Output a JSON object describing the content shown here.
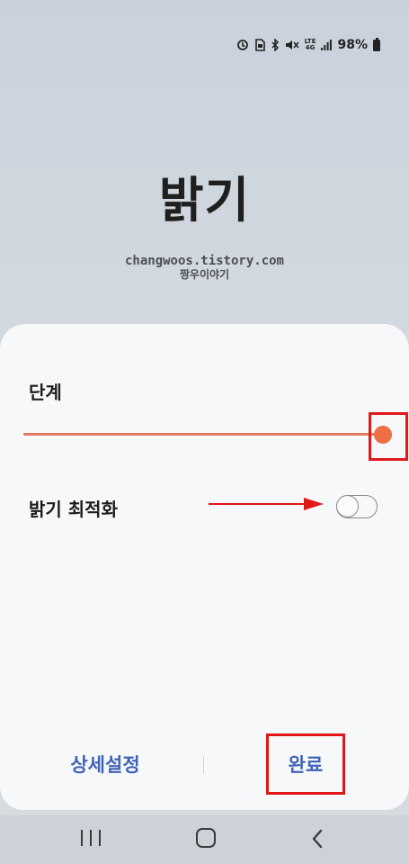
{
  "status_bar": {
    "lte_top": "LTE",
    "lte_bottom": "4G",
    "battery": "98%",
    "icons": [
      "data-saver-icon",
      "sim-icon",
      "bluetooth-icon",
      "mute-icon",
      "lte-icon",
      "signal-icon",
      "battery-icon"
    ]
  },
  "page": {
    "title": "밝기",
    "watermark_url": "changwoos.tistory.com",
    "watermark_nick": "짱우이야기"
  },
  "panel": {
    "level_label": "단계",
    "slider_value": 1.0,
    "optimize_label": "밝기 최적화",
    "optimize_on": false,
    "detail_button": "상세설정",
    "done_button": "완료"
  },
  "colors": {
    "accent": "#ef6f45",
    "button_text": "#3f63b8",
    "highlight": "#e01818",
    "panel_bg": "#f7f8fa"
  },
  "navbar": {
    "icons": [
      "recent-apps-icon",
      "home-icon",
      "back-icon"
    ]
  }
}
